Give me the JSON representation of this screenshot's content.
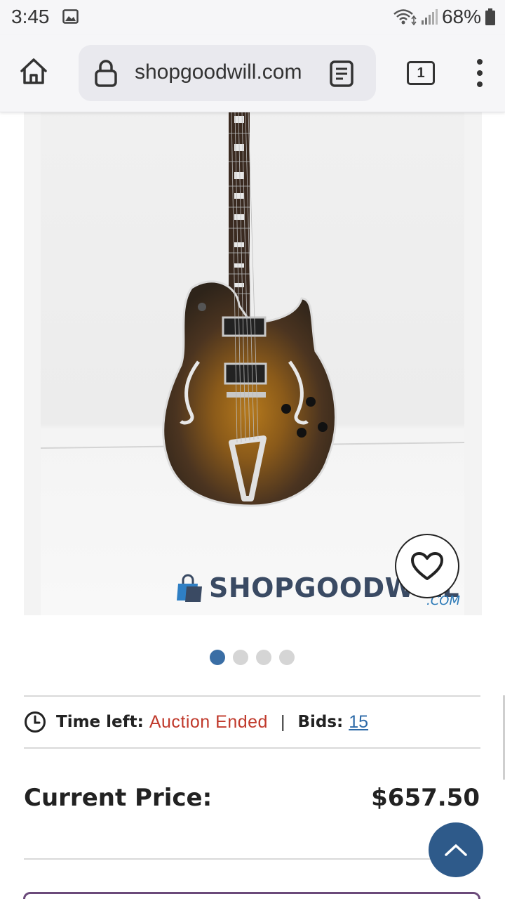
{
  "status_bar": {
    "time": "3:45",
    "battery": "68%",
    "icons": [
      "image-notification-icon",
      "wifi-icon",
      "signal-icon",
      "battery-icon"
    ]
  },
  "browser": {
    "url": "shopgoodwill.com",
    "tab_count": "1",
    "icons": [
      "home-icon",
      "lock-icon",
      "reader-mode-icon",
      "menu-dots-icon"
    ]
  },
  "product": {
    "watermark": "SHOPGOODWILL",
    "watermark_suffix": ".COM",
    "carousel": {
      "count": 4,
      "active": 0
    }
  },
  "auction": {
    "time_left_label": "Time left:",
    "time_left_value": "Auction Ended",
    "separator": "|",
    "bids_label": "Bids:",
    "bids_value": "15"
  },
  "price": {
    "label": "Current Price:",
    "value": "$657.50"
  },
  "colors": {
    "accent_blue": "#3a6ea5",
    "ended_red": "#c0392b",
    "scroll_button": "#2e5a8a",
    "link": "#2d6aa8"
  }
}
